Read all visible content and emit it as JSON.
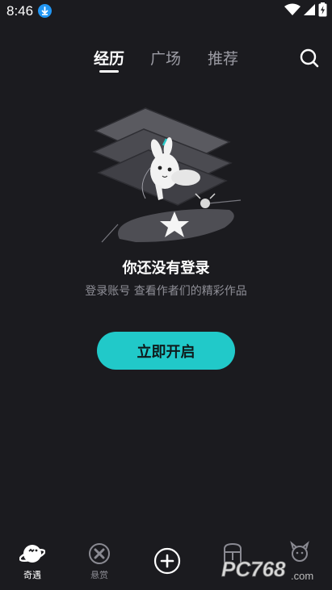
{
  "status_bar": {
    "time": "8:46",
    "download_icon": "download-icon",
    "wifi_icon": "wifi-icon",
    "battery_icon": "battery-charging-icon"
  },
  "tabs": [
    {
      "label": "经历",
      "active": true
    },
    {
      "label": "广场",
      "active": false
    },
    {
      "label": "推荐",
      "active": false
    }
  ],
  "search_icon": "search-icon",
  "empty_state": {
    "illustration": "bunny-flying-illustration",
    "title": "你还没有登录",
    "subtitle": "登录账号 查看作者们的精彩作品",
    "button_label": "立即开启"
  },
  "bottom_nav": [
    {
      "label": "奇遇",
      "icon": "planet-icon",
      "active": true
    },
    {
      "label": "悬赏",
      "icon": "cross-badge-icon",
      "active": false
    },
    {
      "label": "",
      "icon": "add-icon",
      "active": false
    },
    {
      "label": "",
      "icon": "mailbox-icon",
      "active": false
    },
    {
      "label": "",
      "icon": "character-icon",
      "active": false
    }
  ],
  "watermark": {
    "text": "PC768",
    "suffix": ".com"
  },
  "colors": {
    "background": "#1b1b1f",
    "accent": "#21c9c9",
    "inactive": "#9c9ca4"
  }
}
